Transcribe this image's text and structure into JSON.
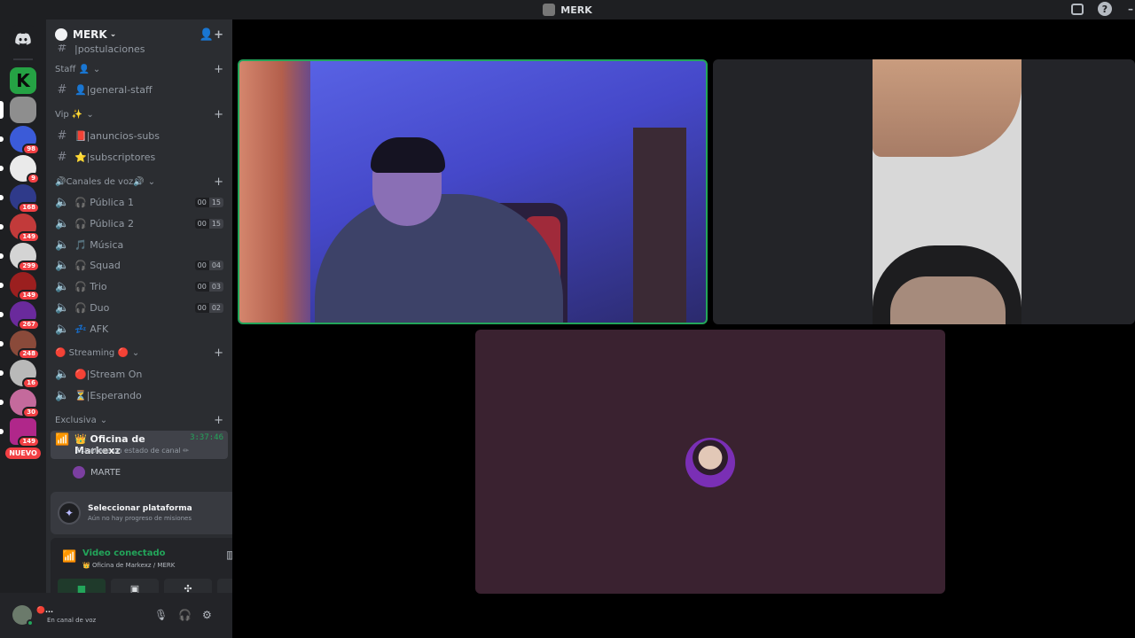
{
  "window": {
    "title": "MERK"
  },
  "server": {
    "name": "MERK"
  },
  "guild_badges": [
    "98",
    "9",
    "168",
    "149",
    "299",
    "149",
    "267",
    "248",
    "16",
    "30",
    "149"
  ],
  "guild_new_label": "NUEVO",
  "channels": {
    "partial_top": "|postulaciones",
    "categories": [
      {
        "name": "Staff 👤",
        "items": [
          {
            "name": "👤|general-staff",
            "type": "text"
          }
        ]
      },
      {
        "name": "Vip ✨",
        "items": [
          {
            "name": "📕|anuncios-subs",
            "type": "text"
          },
          {
            "name": "⭐|subscriptores",
            "type": "text"
          }
        ]
      },
      {
        "name": "🔊Canales de voz🔊",
        "items": [
          {
            "name": "🎧 Pública 1",
            "type": "voice",
            "counts": [
              "00",
              "15"
            ]
          },
          {
            "name": "🎧 Pública 2",
            "type": "voice",
            "counts": [
              "00",
              "15"
            ]
          },
          {
            "name": "🎵 Música",
            "type": "voice"
          },
          {
            "name": "🎧 Squad",
            "type": "voice",
            "counts": [
              "00",
              "04"
            ]
          },
          {
            "name": "🎧 Trio",
            "type": "voice",
            "counts": [
              "00",
              "03"
            ]
          },
          {
            "name": "🎧 Duo",
            "type": "voice",
            "counts": [
              "00",
              "02"
            ]
          },
          {
            "name": "💤 AFK",
            "type": "voice"
          }
        ]
      },
      {
        "name": "🔴 Streaming 🔴",
        "items": [
          {
            "name": "🔴|Stream On",
            "type": "voice"
          },
          {
            "name": "⏳|Esperando",
            "type": "voice"
          }
        ]
      },
      {
        "name": "Exclusiva",
        "items": []
      }
    ],
    "active": {
      "name": "👑 Oficina de Markexz",
      "timer": "3:37:46",
      "status_hint": "Establece un estado de canal ✏"
    },
    "members": [
      "MARTE"
    ]
  },
  "quest": {
    "title": "Seleccionar plataforma",
    "subtitle": "Aún no hay progreso de misiones"
  },
  "rtc": {
    "status": "Video conectado",
    "location": "👑 Oficina de Markexz / MERK"
  },
  "user": {
    "name": "🔴...",
    "status": "En canal de voz"
  }
}
